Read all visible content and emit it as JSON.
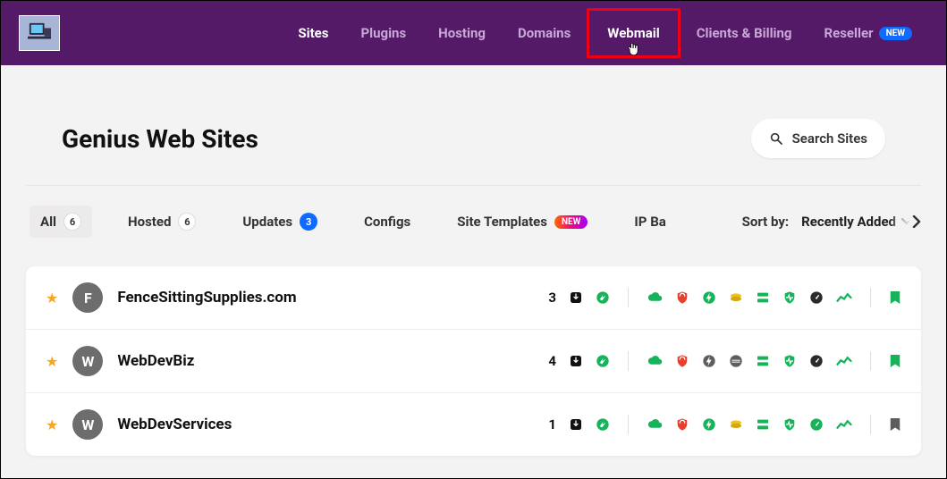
{
  "nav": {
    "sites": "Sites",
    "plugins": "Plugins",
    "hosting": "Hosting",
    "domains": "Domains",
    "webmail": "Webmail",
    "clients_billing": "Clients & Billing",
    "reseller": "Reseller",
    "new_badge": "NEW"
  },
  "header": {
    "title": "Genius Web Sites",
    "search_placeholder": "Search Sites"
  },
  "filters": {
    "all": "All",
    "all_count": "6",
    "hosted": "Hosted",
    "hosted_count": "6",
    "updates": "Updates",
    "updates_count": "3",
    "configs": "Configs",
    "site_templates": "Site Templates",
    "site_templates_new": "NEW",
    "ip_ba": "IP Ba",
    "sort_by": "Sort by:",
    "sort_value": "Recently Added"
  },
  "sites": [
    {
      "initial": "F",
      "name": "FenceSittingSupplies.com",
      "updates": "3"
    },
    {
      "initial": "W",
      "name": "WebDevBiz",
      "updates": "4"
    },
    {
      "initial": "W",
      "name": "WebDevServices",
      "updates": "1"
    }
  ],
  "colors": {
    "green": "#16b35a",
    "red": "#e8402f",
    "yellow": "#f1c40f",
    "gray": "#5d5d5d",
    "dark": "#2a2a2a",
    "blue": "#0f6bff"
  }
}
